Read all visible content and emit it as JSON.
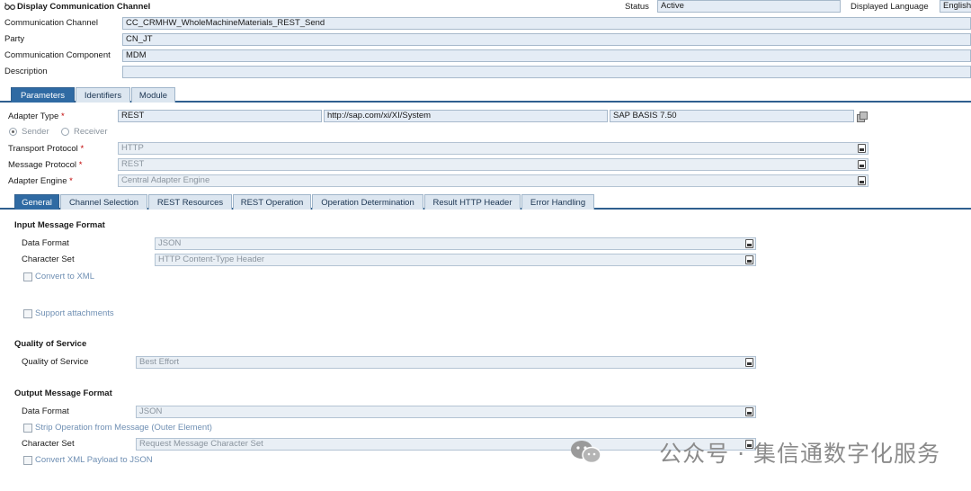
{
  "header": {
    "title": "Display Communication Channel",
    "status_label": "Status",
    "status_value": "Active",
    "language_label": "Displayed Language",
    "language_value": "English"
  },
  "channel": {
    "communication_channel_label": "Communication Channel",
    "communication_channel_value": "CC_CRMHW_WholeMachineMaterials_REST_Send",
    "party_label": "Party",
    "party_value": "CN_JT",
    "component_label": "Communication Component",
    "component_value": "MDM",
    "description_label": "Description",
    "description_value": ""
  },
  "main_tabs": [
    "Parameters",
    "Identifiers",
    "Module"
  ],
  "params": {
    "adapter_type_label": "Adapter Type",
    "adapter_type_value": "REST",
    "adapter_namespace": "http://sap.com/xi/XI/System",
    "adapter_swc": "SAP BASIS 7.50",
    "sender_label": "Sender",
    "receiver_label": "Receiver",
    "transport_protocol_label": "Transport Protocol",
    "transport_protocol_value": "HTTP",
    "message_protocol_label": "Message Protocol",
    "message_protocol_value": "REST",
    "adapter_engine_label": "Adapter Engine",
    "adapter_engine_value": "Central Adapter Engine",
    "required_mark": "*"
  },
  "sub_tabs": [
    "General",
    "Channel Selection",
    "REST Resources",
    "REST Operation",
    "Operation Determination",
    "Result HTTP Header",
    "Error Handling"
  ],
  "general": {
    "input_section": "Input Message Format",
    "input_data_format_label": "Data Format",
    "input_data_format_value": "JSON",
    "input_charset_label": "Character Set",
    "input_charset_value": "HTTP Content-Type Header",
    "convert_to_xml_label": "Convert to XML",
    "support_attachments_label": "Support attachments",
    "qos_section": "Quality of Service",
    "qos_label": "Quality of Service",
    "qos_value": "Best Effort",
    "output_section": "Output Message Format",
    "output_data_format_label": "Data Format",
    "output_data_format_value": "JSON",
    "strip_operation_label": "Strip Operation from Message (Outer Element)",
    "output_charset_label": "Character Set",
    "output_charset_value": "Request Message Character Set",
    "convert_xml_payload_label": "Convert XML Payload to JSON"
  },
  "watermark": {
    "text": "公众号 · 集信通数字化服务"
  },
  "icons": {
    "title_icon": "glasses-icon",
    "copy_icon": "copy-icon",
    "dropdown_icon": "dropdown-icon",
    "watermark_icon": "wechat-icon"
  },
  "colors": {
    "active_tab": "#2f6aa3",
    "field_bg": "#e4ecf5",
    "required": "#c00000"
  }
}
